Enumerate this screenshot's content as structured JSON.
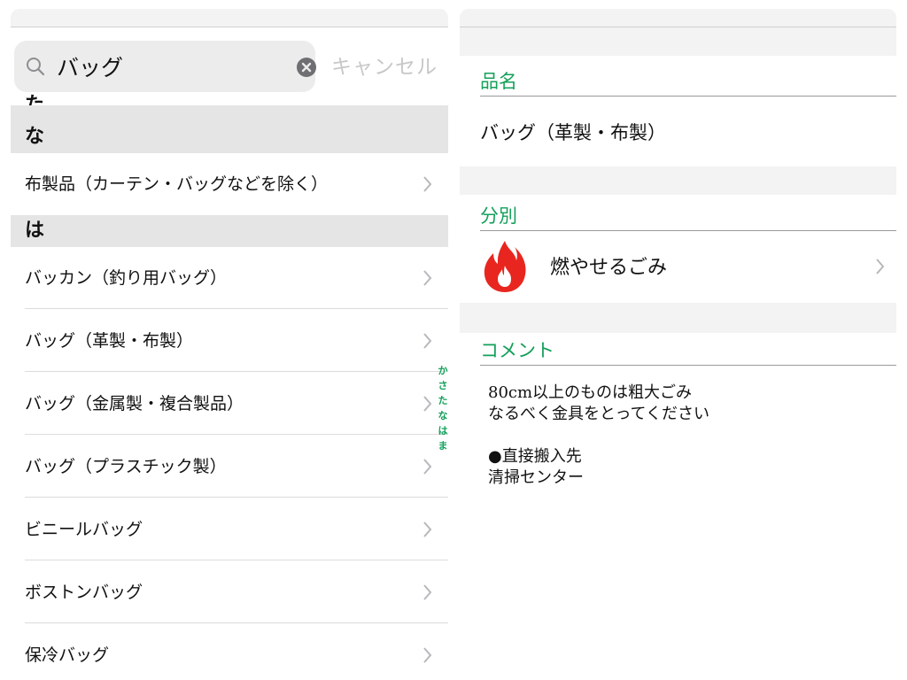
{
  "left": {
    "search": {
      "value": "バッグ",
      "cancel_label": "キャンセル"
    },
    "partial_header": "た",
    "sections": [
      {
        "header": "な",
        "items": [
          "布製品（カーテン・バッグなどを除く）"
        ]
      },
      {
        "header": "は",
        "items": [
          "バッカン（釣り用バッグ）",
          "バッグ（革製・布製）",
          "バッグ（金属製・複合製品）",
          "バッグ（プラスチック製）",
          "ビニールバッグ",
          "ボストンバッグ",
          "保冷バッグ"
        ]
      }
    ],
    "index_letters": [
      "か",
      "さ",
      "た",
      "な",
      "は",
      "ま"
    ]
  },
  "right": {
    "name_header": "品名",
    "name_value": "バッグ（革製・布製）",
    "category_header": "分別",
    "category_label": "燃やせるごみ",
    "category_icon": "fire-icon",
    "comment_header": "コメント",
    "comment_lines": [
      "80cm以上のものは粗大ごみ",
      "なるべく金具をとってください"
    ],
    "comment_lines_2": [
      "●直接搬入先",
      "清掃センター"
    ]
  },
  "colors": {
    "accent": "#14a05a",
    "fire": "#e8261f",
    "section_bg": "#e5e5e5"
  }
}
